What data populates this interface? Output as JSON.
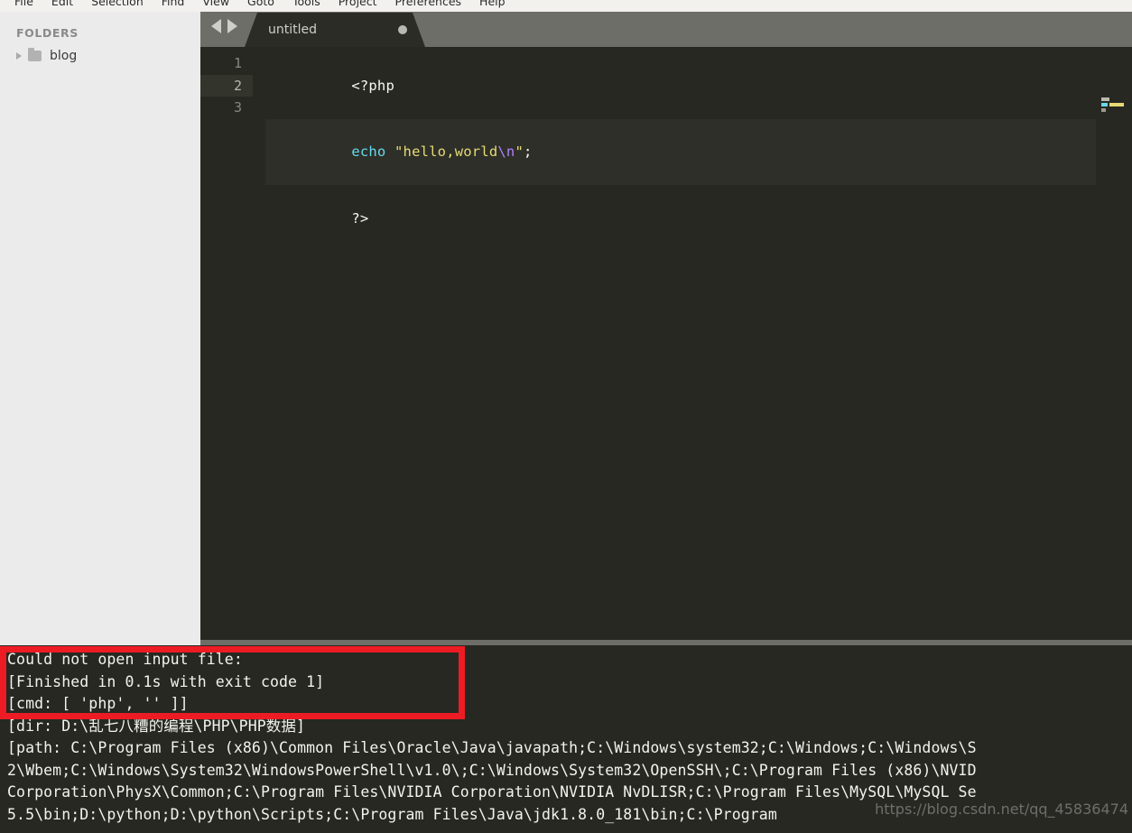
{
  "menubar": {
    "items": [
      {
        "label": "File"
      },
      {
        "label": "Edit"
      },
      {
        "label": "Selection"
      },
      {
        "label": "Find"
      },
      {
        "label": "View"
      },
      {
        "label": "Goto"
      },
      {
        "label": "Tools"
      },
      {
        "label": "Project"
      },
      {
        "label": "Preferences"
      },
      {
        "label": "Help"
      }
    ]
  },
  "sidebar": {
    "header": "FOLDERS",
    "folders": [
      {
        "label": "blog",
        "expanded": false
      }
    ]
  },
  "tabbar": {
    "nav_prev_icon": "arrow-left-icon",
    "nav_next_icon": "arrow-right-icon",
    "tabs": [
      {
        "title": "untitled",
        "dirty": true,
        "active": true
      }
    ]
  },
  "editor": {
    "active_line": 2,
    "lines": [
      {
        "number": "1",
        "text": "<?php",
        "tokens": [
          {
            "t": "<?php",
            "c": "tok-plain"
          }
        ]
      },
      {
        "number": "2",
        "text": "echo \"hello,world\\n\";",
        "tokens": [
          {
            "t": "echo ",
            "c": "tok-kw"
          },
          {
            "t": "\"hello,world",
            "c": "tok-str"
          },
          {
            "t": "\\n",
            "c": "tok-esc"
          },
          {
            "t": "\"",
            "c": "tok-str"
          },
          {
            "t": ";",
            "c": "tok-punc"
          }
        ]
      },
      {
        "number": "3",
        "text": "?>",
        "tokens": [
          {
            "t": "?>",
            "c": "tok-plain"
          }
        ]
      }
    ]
  },
  "console": {
    "lines": [
      {
        "text": "Could not open input file:",
        "highlighted": true
      },
      {
        "text": "[Finished in 0.1s with exit code 1]",
        "highlighted": true
      },
      {
        "text": "[cmd: [ 'php', '' ]]",
        "highlighted": false
      },
      {
        "text": "[dir: D:\\乱七八糟的编程\\PHP\\PHP数据]",
        "highlighted": false
      },
      {
        "text": "[path: C:\\Program Files (x86)\\Common Files\\Oracle\\Java\\javapath;C:\\Windows\\system32;C:\\Windows;C:\\Windows\\S",
        "highlighted": false
      },
      {
        "text": "2\\Wbem;C:\\Windows\\System32\\WindowsPowerShell\\v1.0\\;C:\\Windows\\System32\\OpenSSH\\;C:\\Program Files (x86)\\NVID",
        "highlighted": false
      },
      {
        "text": "Corporation\\PhysX\\Common;C:\\Program Files\\NVIDIA Corporation\\NVIDIA NvDLISR;C:\\Program Files\\MySQL\\MySQL Se",
        "highlighted": false
      },
      {
        "text": "5.5\\bin;D:\\python;D:\\python\\Scripts;C:\\Program Files\\Java\\jdk1.8.0_181\\bin;C:\\Program",
        "highlighted": false
      }
    ]
  },
  "annotation": {
    "color": "#ED1C24",
    "shape": "rectangle"
  },
  "watermark": {
    "text": "https://blog.csdn.net/qq_45836474"
  },
  "colors": {
    "editor_background": "#272822",
    "sidebar_background": "#EBEBEB",
    "chrome_background": "#6E6E68",
    "tab_active_background": "#2B2C26",
    "keyword": "#66D9EF",
    "string": "#E6DB74",
    "escape": "#AE81FF",
    "plain_text": "#F8F8F2",
    "annotation_red": "#ED1C24"
  }
}
